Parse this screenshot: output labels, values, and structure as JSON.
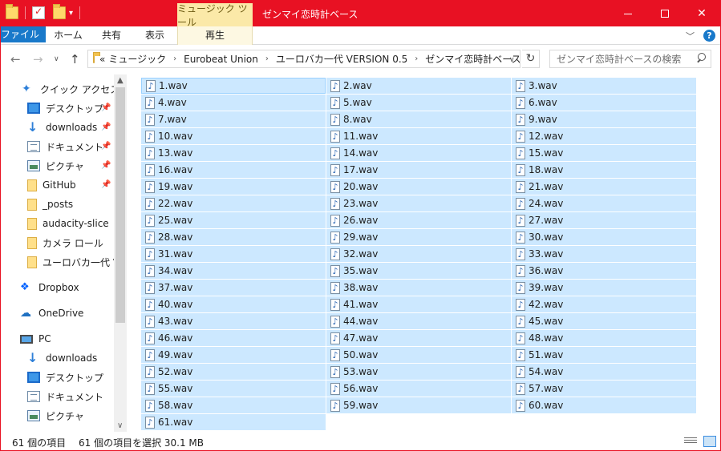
{
  "titlebar": {
    "tools_tab": "ミュージック ツール",
    "title": "ゼンマイ恋時計ベース"
  },
  "ribbon": {
    "tabs": [
      "ファイル",
      "ホーム",
      "共有",
      "表示",
      "再生"
    ]
  },
  "address": {
    "prefix": "«",
    "crumbs": [
      "ミュージック",
      "Eurobeat Union",
      "ユーロバカ一代 VERSION 0.5",
      "ゼンマイ恋時計ベース"
    ]
  },
  "search": {
    "placeholder": "ゼンマイ恋時計ベースの検索"
  },
  "sidebar": {
    "items": [
      {
        "label": "クイック アクセス"
      },
      {
        "label": "デスクトップ"
      },
      {
        "label": "downloads"
      },
      {
        "label": "ドキュメント"
      },
      {
        "label": "ピクチャ"
      },
      {
        "label": "GitHub"
      },
      {
        "label": "_posts"
      },
      {
        "label": "audacity-slice"
      },
      {
        "label": "カメラ ロール"
      },
      {
        "label": "ユーロバカ一代 VE"
      },
      {
        "label": "Dropbox"
      },
      {
        "label": "OneDrive"
      },
      {
        "label": "PC"
      },
      {
        "label": "downloads"
      },
      {
        "label": "デスクトップ"
      },
      {
        "label": "ドキュメント"
      },
      {
        "label": "ピクチャ"
      }
    ]
  },
  "files": [
    "1.wav",
    "2.wav",
    "3.wav",
    "4.wav",
    "5.wav",
    "6.wav",
    "7.wav",
    "8.wav",
    "9.wav",
    "10.wav",
    "11.wav",
    "12.wav",
    "13.wav",
    "14.wav",
    "15.wav",
    "16.wav",
    "17.wav",
    "18.wav",
    "19.wav",
    "20.wav",
    "21.wav",
    "22.wav",
    "23.wav",
    "24.wav",
    "25.wav",
    "26.wav",
    "27.wav",
    "28.wav",
    "29.wav",
    "30.wav",
    "31.wav",
    "32.wav",
    "33.wav",
    "34.wav",
    "35.wav",
    "36.wav",
    "37.wav",
    "38.wav",
    "39.wav",
    "40.wav",
    "41.wav",
    "42.wav",
    "43.wav",
    "44.wav",
    "45.wav",
    "46.wav",
    "47.wav",
    "48.wav",
    "49.wav",
    "50.wav",
    "51.wav",
    "52.wav",
    "53.wav",
    "54.wav",
    "55.wav",
    "56.wav",
    "57.wav",
    "58.wav",
    "59.wav",
    "60.wav",
    "61.wav"
  ],
  "status": {
    "count": "61 個の項目",
    "selected": "61 個の項目を選択  30.1 MB"
  },
  "colors": {
    "titlebar": "#e81123",
    "file_tab": "#1979ca",
    "selection": "#cce8ff"
  }
}
